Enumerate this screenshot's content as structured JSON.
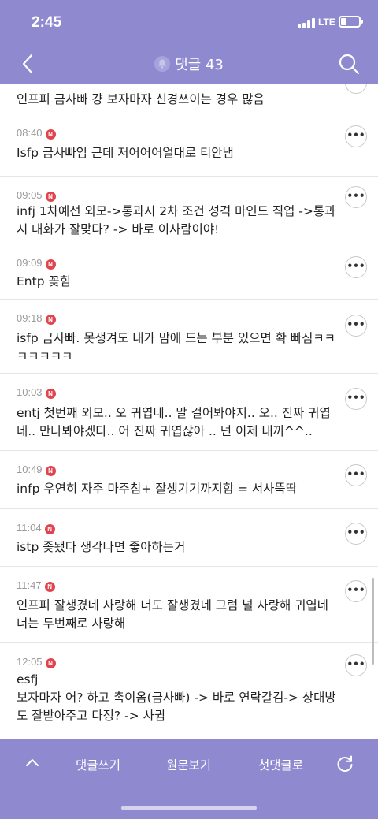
{
  "status_bar": {
    "time": "2:45",
    "network": "LTE"
  },
  "header": {
    "title": "댓글 43"
  },
  "comments": [
    {
      "time": "",
      "badge": "",
      "text": "인프피 금사빠 걍 보자마자 신경쓰이는 경우 많음"
    },
    {
      "time": "08:40",
      "badge": "N",
      "text": "Isfp 금사빠임 근데 저어어어얼대로 티안냄"
    },
    {
      "time": "09:05",
      "badge": "N",
      "text": "infj 1차예선 외모->통과시 2차 조건 성격 마인드 직업 ->통과시 대화가 잘맞다? -> 바로 이사람이야!"
    },
    {
      "time": "09:09",
      "badge": "N",
      "text": "Entp 꽂힘"
    },
    {
      "time": "09:18",
      "badge": "N",
      "text": "isfp 금사빠. 못생겨도 내가 맘에 드는 부분 있으면 확 빠짐ㅋㅋㅋㅋㅋㅋㅋ"
    },
    {
      "time": "10:03",
      "badge": "N",
      "text": "entj 첫번째 외모.. 오 귀엽네.. 말 걸어봐야지.. 오.. 진짜 귀엽네.. 만나봐야겠다.. 어 진짜 귀엽잖아 .. 넌 이제 내꺼^^.."
    },
    {
      "time": "10:49",
      "badge": "N",
      "text": "infp 우연히 자주 마주침+ 잘생기기까지함 = 서사뚝딱"
    },
    {
      "time": "11:04",
      "badge": "N",
      "text": "istp 좆됐다 생각나면 좋아하는거"
    },
    {
      "time": "11:47",
      "badge": "N",
      "text": "인프피 잘생겼네 사랑해 너도 잘생겼네 그럼 널 사랑해 귀엽네 너는 두번째로 사랑해"
    },
    {
      "time": "12:05",
      "badge": "N",
      "text": "esfj\n보자마자 어? 하고 촉이옴(금사빠) -> 바로 연락갈김-> 상대방도 잘받아주고 다정? -> 사귐"
    }
  ],
  "more_label": "•••",
  "bottom_bar": {
    "write": "댓글쓰기",
    "original": "원문보기",
    "first": "첫댓글로"
  },
  "colors": {
    "bar": "#8f8ad0",
    "badge": "#e0454f"
  }
}
